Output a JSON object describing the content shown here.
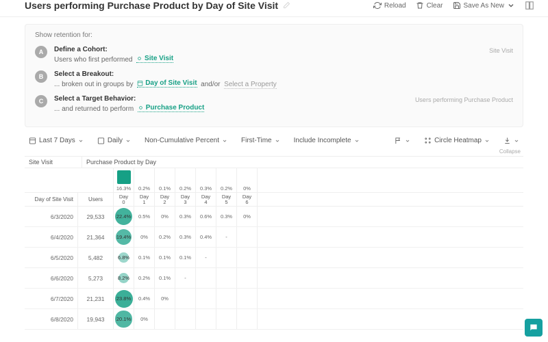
{
  "header": {
    "title": "Users performing Purchase Product by Day of Site Visit",
    "reload": "Reload",
    "clear": "Clear",
    "saveAsNew": "Save As New"
  },
  "config": {
    "showRetention": "Show retention for:",
    "stepA": {
      "badge": "A",
      "title": "Define a Cohort:",
      "sub": "Users who first performed",
      "tag": "Site Visit",
      "sideNote": "Site Visit"
    },
    "stepB": {
      "badge": "B",
      "title": "Select a Breakout:",
      "sub": "... broken out in groups by",
      "tag": "Day of Site Visit",
      "andor": "and/or",
      "prop": "Select a Property"
    },
    "stepC": {
      "badge": "C",
      "title": "Select a Target Behavior:",
      "sub": "... and returned to perform",
      "tag": "Purchase Product",
      "sideNote": "Users performing Purchase Product"
    }
  },
  "filters": {
    "range": "Last 7 Days",
    "grain": "Daily",
    "mode": "Non-Cumulative Percent",
    "firstTime": "First-Time",
    "includeIncomplete": "Include Incomplete",
    "viz": "Circle Heatmap"
  },
  "table": {
    "leftHeader": "Site Visit",
    "rightHeader": "Purchase Product by Day",
    "subLeft": "Day of Site Visit",
    "subUsers": "Users",
    "collapse": "Collapse",
    "dayLabels": [
      "Day\n0",
      "Day\n1",
      "Day\n2",
      "Day\n3",
      "Day\n4",
      "Day\n5",
      "Day\n6"
    ],
    "summary": [
      "16.3%",
      "0.2%",
      "0.1%",
      "0.2%",
      "0.3%",
      "0.2%",
      "0%"
    ]
  },
  "chart_data": {
    "type": "table",
    "title": "Retention circle heatmap — Purchase Product by Day",
    "columns": [
      "Day 0",
      "Day 1",
      "Day 2",
      "Day 3",
      "Day 4",
      "Day 5",
      "Day 6"
    ],
    "rows": [
      {
        "date": "6/3/2020",
        "users": "29,533",
        "cells": [
          "22.4%",
          "0.5%",
          "0%",
          "0.3%",
          "0.6%",
          "0.3%",
          "0%"
        ]
      },
      {
        "date": "6/4/2020",
        "users": "21,364",
        "cells": [
          "19.4%",
          "0%",
          "0.2%",
          "0.3%",
          "0.4%",
          "-",
          null
        ]
      },
      {
        "date": "6/5/2020",
        "users": "5,482",
        "cells": [
          "6.8%",
          "0.1%",
          "0.1%",
          "0.1%",
          "-",
          null,
          null
        ]
      },
      {
        "date": "6/6/2020",
        "users": "5,273",
        "cells": [
          "8.2%",
          "0.2%",
          "0.1%",
          "-",
          null,
          null,
          null
        ]
      },
      {
        "date": "6/7/2020",
        "users": "21,231",
        "cells": [
          "23.8%",
          "0.4%",
          "0%",
          null,
          null,
          null,
          null
        ]
      },
      {
        "date": "6/8/2020",
        "users": "19,943",
        "cells": [
          "20.1%",
          "0%",
          null,
          null,
          null,
          null,
          null
        ]
      }
    ]
  }
}
